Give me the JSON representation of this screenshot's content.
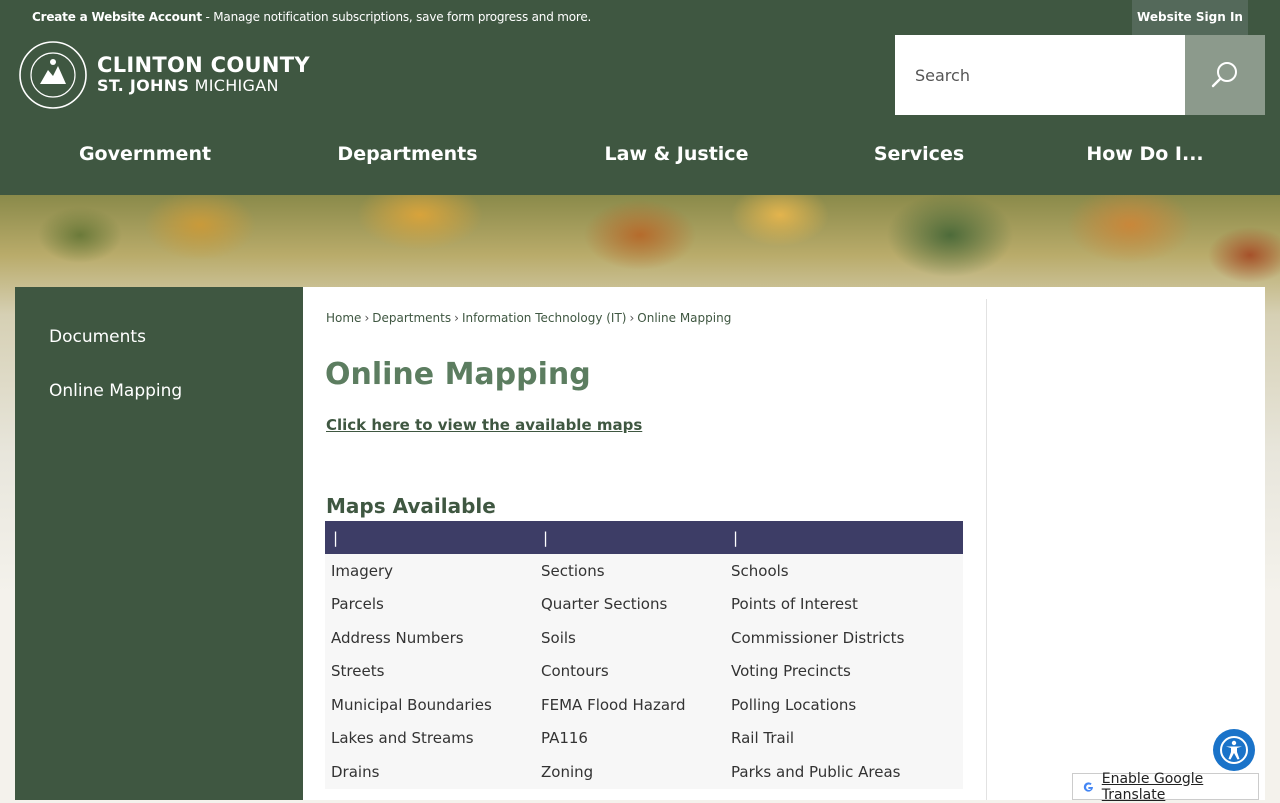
{
  "topbar": {
    "account_link": "Create a Website Account",
    "account_msg": " - Manage notification subscriptions, save form progress and more.",
    "signin": "Website Sign In"
  },
  "logo": {
    "title": "CLINTON COUNTY",
    "sub_bold": "ST. JOHNS",
    "sub_rest": " MICHIGAN",
    "seal_text": "SEAL OF CLINTON COUNTY ST. JOHNS, MICHIGAN"
  },
  "search": {
    "placeholder": "Search"
  },
  "nav": [
    {
      "label": "Government"
    },
    {
      "label": "Departments"
    },
    {
      "label": "Law & Justice"
    },
    {
      "label": "Services"
    },
    {
      "label": "How Do I..."
    }
  ],
  "sidebar": [
    {
      "label": "Documents"
    },
    {
      "label": "Online Mapping"
    }
  ],
  "breadcrumb": [
    {
      "label": "Home"
    },
    {
      "label": "Departments"
    },
    {
      "label": "Information Technology (IT)"
    },
    {
      "label": "Online Mapping"
    }
  ],
  "breadcrumb_sep": "›",
  "page_title": "Online Mapping",
  "maps_link": "Click here to view the available maps",
  "maps_heading": "Maps Available",
  "table": {
    "headers": [
      "|",
      "|",
      "|"
    ],
    "rows": [
      [
        "Imagery",
        "Sections",
        "Schools"
      ],
      [
        "Parcels",
        "Quarter Sections",
        "Points of Interest"
      ],
      [
        "Address Numbers",
        "Soils",
        "Commissioner Districts"
      ],
      [
        "Streets",
        "Contours",
        "Voting Precincts"
      ],
      [
        "Municipal Boundaries",
        "FEMA Flood Hazard",
        "Polling Locations"
      ],
      [
        "Lakes and Streams",
        "PA116",
        "Rail Trail"
      ],
      [
        "Drains",
        "Zoning",
        "Parks and Public Areas"
      ]
    ]
  },
  "translate": {
    "label": "Enable Google Translate"
  },
  "colors": {
    "primary": "#3f5741",
    "title_green": "#5c7d60",
    "table_header": "#3d3d66",
    "accessibility": "#1a73c9"
  }
}
